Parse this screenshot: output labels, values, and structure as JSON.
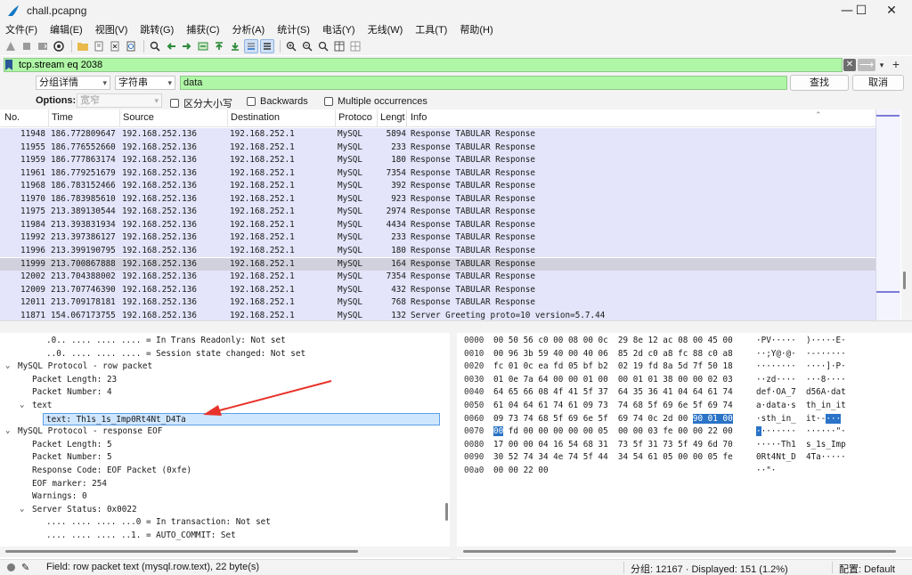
{
  "window": {
    "title": "chall.pcapng",
    "controls": {
      "minimize": "—",
      "maximize": "☐",
      "close": "✕"
    }
  },
  "menubar": {
    "items": [
      "文件(F)",
      "编辑(E)",
      "视图(V)",
      "跳转(G)",
      "捕获(C)",
      "分析(A)",
      "统计(S)",
      "电话(Y)",
      "无线(W)",
      "工具(T)",
      "帮助(H)"
    ]
  },
  "filter": {
    "value": "tcp.stream eq 2038",
    "clear_label": "✕",
    "apply_label": "⟶",
    "dropdown": "▾",
    "add": "+"
  },
  "find": {
    "search_in": "分组详情",
    "search_type": "字符串",
    "query": "data",
    "find_label": "查找",
    "cancel_label": "取消",
    "options_label": "Options:",
    "options_placeholder": "宽窄",
    "case_label": "区分大小写",
    "backwards_label": "Backwards",
    "multiple_label": "Multiple occurrences"
  },
  "packet_list": {
    "columns": [
      "No.",
      "Time",
      "Source",
      "Destination",
      "Protoco",
      "Lengt",
      "Info"
    ],
    "rows": [
      {
        "no": "11948",
        "time": "186.772809647",
        "src": "192.168.252.136",
        "dst": "192.168.252.1",
        "proto": "MySQL",
        "len": "5894",
        "info": "Response TABULAR Response"
      },
      {
        "no": "11955",
        "time": "186.776552660",
        "src": "192.168.252.136",
        "dst": "192.168.252.1",
        "proto": "MySQL",
        "len": "233",
        "info": "Response TABULAR Response"
      },
      {
        "no": "11959",
        "time": "186.777863174",
        "src": "192.168.252.136",
        "dst": "192.168.252.1",
        "proto": "MySQL",
        "len": "180",
        "info": "Response TABULAR Response"
      },
      {
        "no": "11961",
        "time": "186.779251679",
        "src": "192.168.252.136",
        "dst": "192.168.252.1",
        "proto": "MySQL",
        "len": "7354",
        "info": "Response TABULAR Response"
      },
      {
        "no": "11968",
        "time": "186.783152466",
        "src": "192.168.252.136",
        "dst": "192.168.252.1",
        "proto": "MySQL",
        "len": "392",
        "info": "Response TABULAR Response"
      },
      {
        "no": "11970",
        "time": "186.783985610",
        "src": "192.168.252.136",
        "dst": "192.168.252.1",
        "proto": "MySQL",
        "len": "923",
        "info": "Response TABULAR Response"
      },
      {
        "no": "11975",
        "time": "213.389130544",
        "src": "192.168.252.136",
        "dst": "192.168.252.1",
        "proto": "MySQL",
        "len": "2974",
        "info": "Response TABULAR Response"
      },
      {
        "no": "11984",
        "time": "213.393831934",
        "src": "192.168.252.136",
        "dst": "192.168.252.1",
        "proto": "MySQL",
        "len": "4434",
        "info": "Response TABULAR Response"
      },
      {
        "no": "11992",
        "time": "213.397386127",
        "src": "192.168.252.136",
        "dst": "192.168.252.1",
        "proto": "MySQL",
        "len": "233",
        "info": "Response TABULAR Response"
      },
      {
        "no": "11996",
        "time": "213.399190795",
        "src": "192.168.252.136",
        "dst": "192.168.252.1",
        "proto": "MySQL",
        "len": "180",
        "info": "Response TABULAR Response"
      },
      {
        "no": "11999",
        "time": "213.700867888",
        "src": "192.168.252.136",
        "dst": "192.168.252.1",
        "proto": "MySQL",
        "len": "164",
        "info": "Response TABULAR Response",
        "selected": true
      },
      {
        "no": "12002",
        "time": "213.704388002",
        "src": "192.168.252.136",
        "dst": "192.168.252.1",
        "proto": "MySQL",
        "len": "7354",
        "info": "Response TABULAR Response"
      },
      {
        "no": "12009",
        "time": "213.707746390",
        "src": "192.168.252.136",
        "dst": "192.168.252.1",
        "proto": "MySQL",
        "len": "432",
        "info": "Response TABULAR Response"
      },
      {
        "no": "12011",
        "time": "213.709178181",
        "src": "192.168.252.136",
        "dst": "192.168.252.1",
        "proto": "MySQL",
        "len": "768",
        "info": "Response TABULAR Response"
      },
      {
        "no": "11871",
        "time": "154.067173755",
        "src": "192.168.252.136",
        "dst": "192.168.252.1",
        "proto": "MySQL",
        "len": "132",
        "info": "Server Greeting  proto=10 version=5.7.44"
      }
    ]
  },
  "details": {
    "rows": [
      {
        "indent": 3,
        "toggle": "",
        "text": ".0.. .... .... .... = In Trans Readonly: Not set"
      },
      {
        "indent": 3,
        "toggle": "",
        "text": "..0. .... .... .... = Session state changed: Not set"
      },
      {
        "indent": 0,
        "toggle": "⌄",
        "text": "MySQL Protocol - row packet"
      },
      {
        "indent": 1,
        "toggle": "",
        "text": "Packet Length: 23"
      },
      {
        "indent": 1,
        "toggle": "",
        "text": "Packet Number: 4"
      },
      {
        "indent": 1,
        "toggle": "⌄",
        "text": "text"
      },
      {
        "indent": 2,
        "toggle": "",
        "text": "text: Th1s_1s_Imp0Rt4Nt_D4Ta",
        "selected": true
      },
      {
        "indent": 0,
        "toggle": "⌄",
        "text": "MySQL Protocol - response EOF"
      },
      {
        "indent": 1,
        "toggle": "",
        "text": "Packet Length: 5"
      },
      {
        "indent": 1,
        "toggle": "",
        "text": "Packet Number: 5"
      },
      {
        "indent": 1,
        "toggle": "",
        "text": "Response Code: EOF Packet (0xfe)"
      },
      {
        "indent": 1,
        "toggle": "",
        "text": "EOF marker: 254"
      },
      {
        "indent": 1,
        "toggle": "",
        "text": "Warnings: 0"
      },
      {
        "indent": 1,
        "toggle": "⌄",
        "text": "Server Status: 0x0022"
      },
      {
        "indent": 3,
        "toggle": "",
        "text": ".... .... .... ...0 = In transaction: Not set"
      },
      {
        "indent": 3,
        "toggle": "",
        "text": ".... .... .... ..1. = AUTO_COMMIT: Set"
      }
    ]
  },
  "bytes": {
    "rows": [
      {
        "off": "0000",
        "hex": "00 50 56 c0 00 08 00 0c  29 8e 12 ac 08 00 45 00",
        "ascii": "·PV·····  )·····E·"
      },
      {
        "off": "0010",
        "hex": "00 96 3b 59 40 00 40 06  85 2d c0 a8 fc 88 c0 a8",
        "ascii": "··;Y@·@·  ·-······"
      },
      {
        "off": "0020",
        "hex": "fc 01 0c ea fd 05 bf b2  02 19 fd 8a 5d 7f 50 18",
        "ascii": "········  ····]·P·"
      },
      {
        "off": "0030",
        "hex": "01 0e 7a 64 00 00 01 00  00 01 01 38 00 00 02 03",
        "ascii": "··zd····  ···8····"
      },
      {
        "off": "0040",
        "hex": "64 65 66 08 4f 41 5f 37  64 35 36 41 04 64 61 74",
        "ascii": "def·OA_7  d56A·dat"
      },
      {
        "off": "0050",
        "hex": "61 04 64 61 74 61 09 73  74 68 5f 69 6e 5f 69 74",
        "ascii": "a·data·s  th_in_it"
      },
      {
        "off": "0060",
        "hex_pre": "09 73 74 68 5f 69 6e 5f  69 74 0c 2d 00 ",
        "hex_hl": "90 01 00",
        "hex_post": "",
        "ascii_pre": "·sth_in_  it·-",
        "ascii_hl": "···",
        "ascii_post": ""
      },
      {
        "off": "0070",
        "hex_hl": "00",
        "hex_post": " fd 00 00 00 00 00 05  00 00 03 fe 00 00 22 00",
        "ascii_hl": "·",
        "ascii_post": "·······  ······\"·"
      },
      {
        "off": "0080",
        "hex": "17 00 00 04 16 54 68 31  73 5f 31 73 5f 49 6d 70",
        "ascii": "·····Th1  s_1s_Imp"
      },
      {
        "off": "0090",
        "hex": "30 52 74 34 4e 74 5f 44  34 54 61 05 00 00 05 fe",
        "ascii": "0Rt4Nt_D  4Ta·····"
      },
      {
        "off": "00a0",
        "hex": "00 00 22 00",
        "ascii": "··\"·"
      }
    ]
  },
  "status": {
    "field": "Field: row packet text (mysql.row.text), 22 byte(s)",
    "packets": "分组: 12167 · Displayed: 151 (1.2%)",
    "profile": "配置: Default"
  },
  "colors": {
    "filter_bg": "#aff7a6",
    "row_bg": "#e4e4fa",
    "row_selected": "#d1d1de",
    "byte_highlight": "#2a73c7",
    "annotation": "#e8332a"
  }
}
